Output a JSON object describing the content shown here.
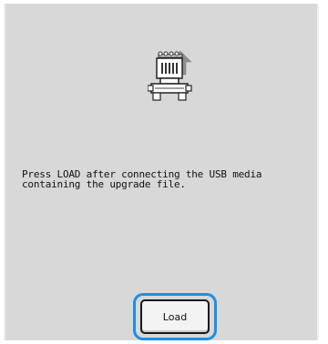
{
  "screen": {
    "icon": "machine-upgrade-icon",
    "message": "Press LOAD after connecting the USB media\ncontaining the upgrade file.",
    "load_button_label": "Load"
  },
  "colors": {
    "background": "#d8d8d8",
    "highlight": "#1e8fe6",
    "button_face": "#f3f3f3",
    "arrow": "#8a8a8a"
  }
}
